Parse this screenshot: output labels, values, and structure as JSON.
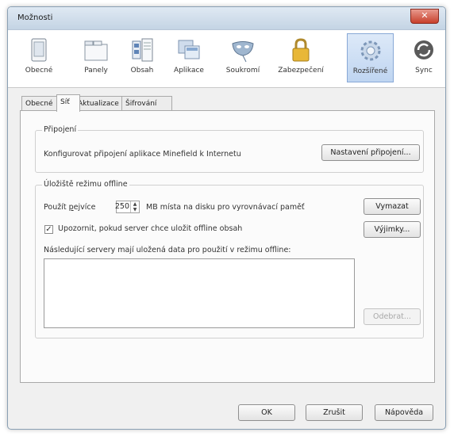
{
  "window": {
    "title": "Možnosti",
    "close_glyph": "✕"
  },
  "toolbar": {
    "panes": [
      {
        "label": "Obecné",
        "icon": "general-icon"
      },
      {
        "label": "Panely",
        "icon": "tabs-icon"
      },
      {
        "label": "Obsah",
        "icon": "content-icon"
      },
      {
        "label": "Aplikace",
        "icon": "applications-icon"
      },
      {
        "label": "Soukromí",
        "icon": "privacy-mask-icon"
      },
      {
        "label": "Zabezpečení",
        "icon": "padlock-icon"
      },
      {
        "label": "Rozšířené",
        "icon": "advanced-gear-icon",
        "selected": true
      },
      {
        "label": "Sync",
        "icon": "sync-icon"
      }
    ]
  },
  "tabs": [
    "Obecné",
    "Síť",
    "Aktualizace",
    "Šifrování"
  ],
  "active_tab": "Síť",
  "connection": {
    "legend": "Připojení",
    "description": "Konfigurovat připojení aplikace Minefield k Internetu",
    "settings_button": "Nastavení připojení..."
  },
  "offline": {
    "legend": "Úložiště režimu offline",
    "use_prefix": "Použít ",
    "use_accel": "p",
    "use_rest": "ejvíce",
    "cache_size": "250",
    "cache_suffix": "MB místa na disku pro vyrovnávací paměť",
    "clear_button": "Vymazat",
    "notify_checkbox_label": "Upozornit, pokud server chce uložit offline obsah",
    "notify_checked": true,
    "check_glyph": "✓",
    "exceptions_button": "Výjimky...",
    "servers_label": "Následující servery mají uložená data pro použití v režimu offline:",
    "remove_button": "Odebrat..."
  },
  "footer": {
    "ok_button": "OK",
    "cancel_button": "Zrušit",
    "help_button": "Nápověda"
  }
}
